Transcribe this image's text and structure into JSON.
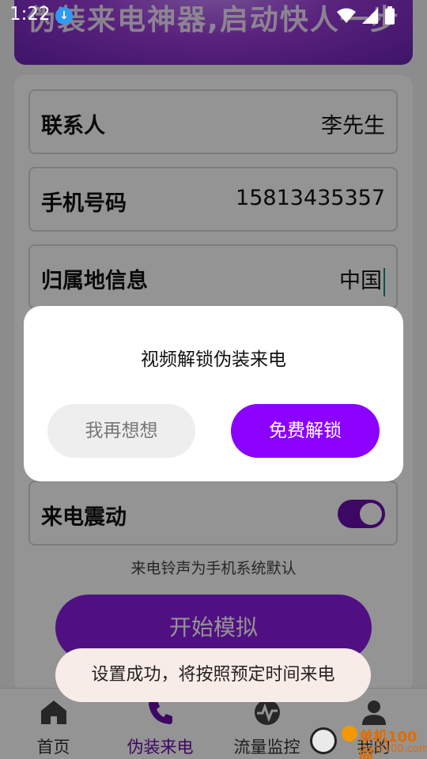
{
  "status_bar": {
    "time": "1:22",
    "download_badge": "↓",
    "icons": [
      "wifi-icon",
      "signal-icon",
      "battery-icon"
    ]
  },
  "banner": {
    "text": "伪装来电神器,启动快人一步"
  },
  "form": {
    "fields": [
      {
        "label": "联系人",
        "value": "李先生"
      },
      {
        "label": "手机号码",
        "value": "15813435357"
      },
      {
        "label": "归属地信息",
        "value": "中国"
      },
      {
        "label": "来电震动",
        "toggle_on": true
      }
    ],
    "hint": "来电铃声为手机系统默认",
    "start_button": "开始模拟"
  },
  "dialog": {
    "title": "视频解锁伪装来电",
    "cancel_label": "我再想想",
    "unlock_label": "免费解锁"
  },
  "toast": {
    "text": "设置成功，将按照预定时间来电"
  },
  "bottom_nav": {
    "items": [
      {
        "label": "首页",
        "icon": "home-icon"
      },
      {
        "label": "伪装来电",
        "icon": "phone-icon",
        "active": true
      },
      {
        "label": "流量监控",
        "icon": "traffic-icon"
      },
      {
        "label": "我的",
        "icon": "user-icon"
      }
    ]
  },
  "watermark": {
    "text": "单机100网",
    "url": "danji100.com"
  },
  "colors": {
    "accent": "#8b00ff",
    "toggle": "#6a0dad",
    "banner": "#9a3bd8"
  }
}
